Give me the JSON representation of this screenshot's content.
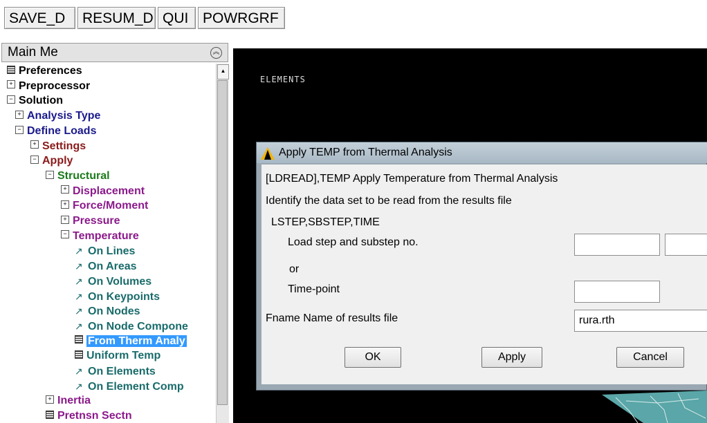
{
  "toolbar": {
    "buttons": [
      "SAVE_D",
      "RESUM_D",
      "QUI",
      "POWRGRF"
    ]
  },
  "sidebar": {
    "title": "Main Me",
    "collapse_icon": "double-chevron-up-icon",
    "tree": [
      {
        "label": "Preferences",
        "icon": "grid",
        "level": 0,
        "color": "#000000"
      },
      {
        "label": "Preprocessor",
        "icon": "plus",
        "level": 0,
        "color": "#000000"
      },
      {
        "label": "Solution",
        "icon": "minus",
        "level": 0,
        "color": "#000000"
      },
      {
        "label": "Analysis Type",
        "icon": "plus",
        "level": 1,
        "color": "#1a1a8c"
      },
      {
        "label": "Define Loads",
        "icon": "minus",
        "level": 1,
        "color": "#1a1a8c"
      },
      {
        "label": "Settings",
        "icon": "plus",
        "level": 2,
        "color": "#8b1a1a"
      },
      {
        "label": "Apply",
        "icon": "minus",
        "level": 2,
        "color": "#8b1a1a"
      },
      {
        "label": "Structural",
        "icon": "minus",
        "level": 3,
        "color": "#1a7a1a"
      },
      {
        "label": "Displacement",
        "icon": "plus",
        "level": 4,
        "color": "#8b1a8b"
      },
      {
        "label": "Force/Moment",
        "icon": "plus",
        "level": 4,
        "color": "#8b1a8b"
      },
      {
        "label": "Pressure",
        "icon": "plus",
        "level": 4,
        "color": "#8b1a8b"
      },
      {
        "label": "Temperature",
        "icon": "minus",
        "level": 4,
        "color": "#8b1a8b"
      },
      {
        "label": "On Lines",
        "icon": "arrow",
        "level": 5,
        "color": "#1a6b6b"
      },
      {
        "label": "On Areas",
        "icon": "arrow",
        "level": 5,
        "color": "#1a6b6b"
      },
      {
        "label": "On Volumes",
        "icon": "arrow",
        "level": 5,
        "color": "#1a6b6b"
      },
      {
        "label": "On Keypoints",
        "icon": "arrow",
        "level": 5,
        "color": "#1a6b6b"
      },
      {
        "label": "On Nodes",
        "icon": "arrow",
        "level": 5,
        "color": "#1a6b6b"
      },
      {
        "label": "On Node Compone",
        "icon": "arrow",
        "level": 5,
        "color": "#1a6b6b"
      },
      {
        "label": "From Therm Analy",
        "icon": "grid",
        "level": 5,
        "color": "#1a6b6b",
        "selected": true
      },
      {
        "label": "Uniform Temp",
        "icon": "grid",
        "level": 5,
        "color": "#1a6b6b"
      },
      {
        "label": "On Elements",
        "icon": "arrow",
        "level": 5,
        "color": "#1a6b6b"
      },
      {
        "label": "On Element Comp",
        "icon": "arrow",
        "level": 5,
        "color": "#1a6b6b"
      },
      {
        "label": "Inertia",
        "icon": "plus",
        "level": 3,
        "color": "#8b1a8b"
      },
      {
        "label": "Pretnsn Sectn",
        "icon": "grid",
        "level": 3,
        "color": "#8b1a8b"
      }
    ]
  },
  "graphics": {
    "label": "ELEMENTS"
  },
  "dialog": {
    "title": "Apply TEMP from Thermal Analysis",
    "heading": "[LDREAD],TEMP  Apply Temperature from Thermal Analysis",
    "instruction": "Identify the data set to be read from the results file",
    "group_label": "LSTEP,SBSTEP,TIME",
    "load_step_label": "Load step and substep no.",
    "load_step_value": "",
    "substep_value": "",
    "or_label": "or",
    "time_point_label": "Time-point",
    "time_point_value": "",
    "fname_label": "Fname  Name of results file",
    "fname_value": "rura.rth",
    "ok": "OK",
    "apply": "Apply",
    "cancel": "Cancel"
  },
  "colors": {
    "selection": "#3399ff",
    "graphics_bg": "#000000",
    "dialog_frame": "#9aa8b3"
  }
}
